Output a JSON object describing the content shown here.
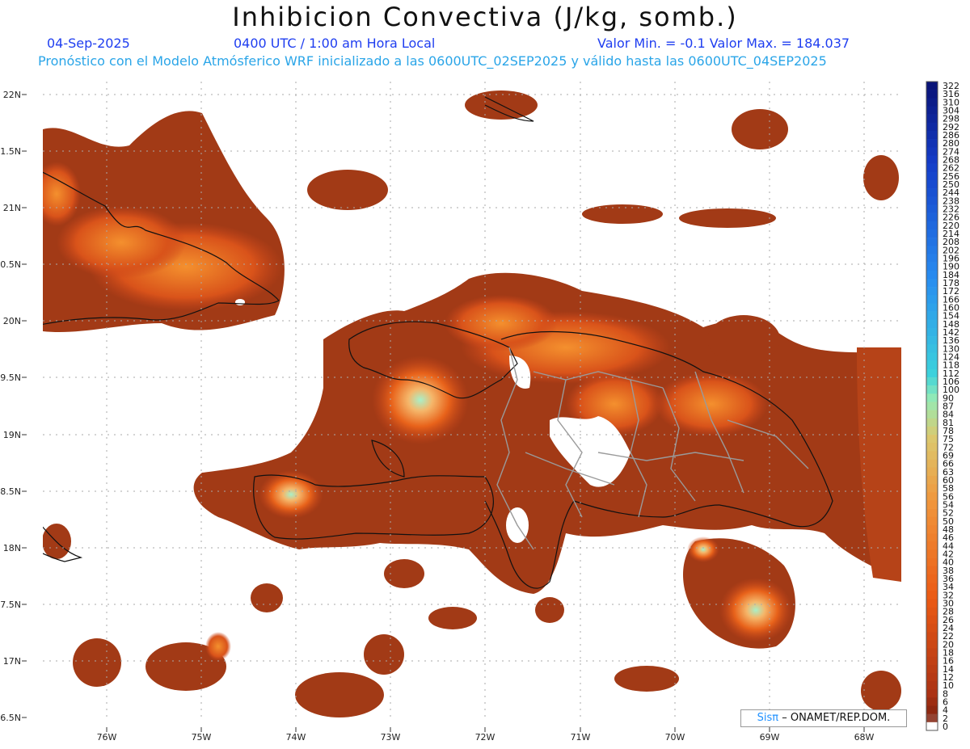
{
  "header": {
    "title": "Inhibicion Convectiva (J/kg, somb.)",
    "date": "04-Sep-2025",
    "time": "0400 UTC / 1:00 am Hora Local",
    "minmax": "Valor Min. = -0.1  Valor Max. = 184.037",
    "forecast": "Pronóstico con el Modelo Atmósferico WRF inicializado a las 0600UTC_02SEP2025 y válido hasta las  0600UTC_04SEP2025"
  },
  "lat_labels": [
    "22N",
    "1.5N",
    "21N",
    "0.5N",
    "20N",
    "9.5N",
    "19N",
    "8.5N",
    "18N",
    "7.5N",
    "17N",
    "6.5N"
  ],
  "lon_labels": [
    "76W",
    "75W",
    "74W",
    "73W",
    "72W",
    "71W",
    "70W",
    "69W",
    "68W"
  ],
  "colorbar": {
    "levels": [
      "322",
      "316",
      "310",
      "304",
      "298",
      "292",
      "286",
      "280",
      "274",
      "268",
      "262",
      "256",
      "250",
      "244",
      "238",
      "232",
      "226",
      "220",
      "214",
      "208",
      "202",
      "196",
      "190",
      "184",
      "178",
      "172",
      "166",
      "160",
      "154",
      "148",
      "142",
      "136",
      "130",
      "124",
      "118",
      "112",
      "106",
      "100",
      "90",
      "87",
      "84",
      "81",
      "78",
      "75",
      "72",
      "69",
      "66",
      "63",
      "60",
      "58",
      "56",
      "54",
      "52",
      "50",
      "48",
      "46",
      "44",
      "42",
      "40",
      "38",
      "36",
      "34",
      "32",
      "30",
      "28",
      "26",
      "24",
      "22",
      "20",
      "18",
      "16",
      "14",
      "12",
      "10",
      "8",
      "6",
      "4",
      "2",
      "0"
    ]
  },
  "credit": {
    "brand": "Sisπ",
    "text": "– ONAMET/REP.DOM."
  },
  "colors": {
    "field_dark": "#9c3714",
    "field_mid": "#d24a10",
    "field_hot": "#f4862a",
    "field_peak": "#9fe8c0"
  }
}
